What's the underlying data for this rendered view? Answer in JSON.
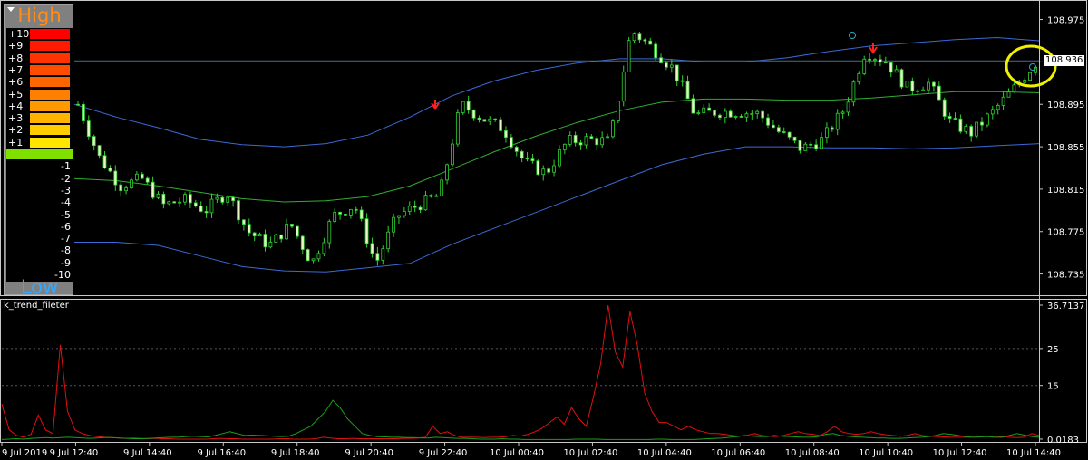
{
  "gauge": {
    "high_label": "High",
    "low_label": "Low",
    "levels": [
      {
        "label": "+10",
        "color": "#ff0000"
      },
      {
        "label": "+9",
        "color": "#ff1a00"
      },
      {
        "label": "+8",
        "color": "#ff3300"
      },
      {
        "label": "+7",
        "color": "#ff4d00"
      },
      {
        "label": "+6",
        "color": "#ff6600"
      },
      {
        "label": "+5",
        "color": "#ff8000"
      },
      {
        "label": "+4",
        "color": "#ff9900"
      },
      {
        "label": "+3",
        "color": "#ffb300"
      },
      {
        "label": "+2",
        "color": "#ffcc00"
      },
      {
        "label": "+1",
        "color": "#ffe600"
      },
      {
        "label": "",
        "color": "#7fe000"
      },
      {
        "label": "-1",
        "color": ""
      },
      {
        "label": "-2",
        "color": ""
      },
      {
        "label": "-3",
        "color": ""
      },
      {
        "label": "-4",
        "color": ""
      },
      {
        "label": "-5",
        "color": ""
      },
      {
        "label": "-6",
        "color": ""
      },
      {
        "label": "-7",
        "color": ""
      },
      {
        "label": "-8",
        "color": ""
      },
      {
        "label": "-9",
        "color": ""
      },
      {
        "label": "-10",
        "color": ""
      }
    ]
  },
  "chart_data": [
    {
      "type": "line",
      "ylim": [
        108.715,
        108.99
      ],
      "ticks": [
        "108.975",
        "108.935",
        "108.895",
        "108.855",
        "108.815",
        "108.775",
        "108.735"
      ],
      "tick_values": [
        108.975,
        108.935,
        108.895,
        108.855,
        108.815,
        108.775,
        108.735
      ],
      "current_price": "108.936",
      "current_value": 108.936,
      "x_labels": [
        "9 Jul 2019",
        "9 Jul 12:40",
        "9 Jul 14:40",
        "9 Jul 16:40",
        "9 Jul 18:40",
        "9 Jul 20:40",
        "9 Jul 22:40",
        "10 Jul 00:40",
        "10 Jul 02:40",
        "10 Jul 04:40",
        "10 Jul 06:40",
        "10 Jul 08:40",
        "10 Jul 10:40",
        "10 Jul 12:40",
        "10 Jul 14:40"
      ],
      "close_anchors": [
        108.895,
        108.845,
        108.818,
        108.825,
        108.8,
        108.805,
        108.795,
        108.812,
        108.775,
        108.762,
        108.782,
        108.745,
        108.79,
        108.8,
        108.745,
        108.79,
        108.8,
        108.81,
        108.895,
        108.882,
        108.872,
        108.84,
        108.83,
        108.86,
        108.862,
        108.86,
        108.965,
        108.948,
        108.928,
        108.885,
        108.888,
        108.888,
        108.886,
        108.868,
        108.853,
        108.862,
        108.89,
        108.945,
        108.935,
        108.91,
        108.915,
        108.878,
        108.868,
        108.888,
        108.91,
        108.934
      ],
      "series": [
        {
          "name": "",
          "color": "#3a6ad4",
          "values": [
            108.765,
            108.765,
            108.762,
            108.752,
            108.742,
            108.738,
            108.737,
            108.741,
            108.745,
            108.763,
            108.778,
            108.793,
            108.808,
            108.823,
            108.838,
            108.848,
            108.855,
            108.855,
            108.854,
            108.854,
            108.853,
            108.854,
            108.856,
            108.858
          ]
        },
        {
          "name": "",
          "color": "#2fae2f",
          "values": [
            108.825,
            108.823,
            108.818,
            108.812,
            108.806,
            108.803,
            108.804,
            108.808,
            108.818,
            108.834,
            108.85,
            108.865,
            108.878,
            108.889,
            108.897,
            108.9,
            108.9,
            108.899,
            108.899,
            108.901,
            108.904,
            108.907,
            108.907,
            108.906
          ]
        },
        {
          "name": "",
          "color": "#3a6ad4",
          "values": [
            108.895,
            108.883,
            108.873,
            108.862,
            108.857,
            108.855,
            108.858,
            108.866,
            108.883,
            108.903,
            108.917,
            108.927,
            108.934,
            108.938,
            108.938,
            108.935,
            108.935,
            108.939,
            108.945,
            108.95,
            108.953,
            108.956,
            108.958,
            108.955
          ]
        }
      ]
    },
    {
      "type": "line",
      "title": "k_trend_fileter",
      "ylim": [
        0,
        36.7137
      ],
      "ticks": [
        "36.7137",
        "25",
        "15",
        "0.0183"
      ],
      "tick_values": [
        36.7137,
        25,
        15,
        0.5
      ],
      "series": [
        {
          "name": "",
          "color": "#e01010",
          "values": [
            10,
            3,
            1.5,
            1,
            1.8,
            7,
            3,
            2,
            26,
            8,
            3,
            2,
            1.5,
            1.2,
            1,
            0.9,
            0.8,
            0.7,
            0.8,
            0.7,
            0.6,
            0.7,
            0.6,
            0.6,
            0.5,
            0.5,
            0.5,
            0.5,
            0.5,
            0.6,
            0.7,
            0.6,
            0.6,
            0.5,
            0.5,
            0.5,
            0.5,
            0.5,
            0.6,
            0.6,
            0.5,
            0.5,
            0.5,
            0.6,
            1,
            0.8,
            0.6,
            0.6,
            0.7,
            0.6,
            0.6,
            0.6,
            0.6,
            0.6,
            0.6,
            0.7,
            0.7,
            0.8,
            1,
            4,
            2,
            2.5,
            1.5,
            1,
            1,
            1,
            0.9,
            1,
            1,
            1.2,
            1.5,
            1.3,
            1.8,
            2.5,
            3.5,
            5,
            6.5,
            4.5,
            9,
            6,
            4,
            12,
            21,
            36.7,
            24,
            20,
            35,
            26,
            13,
            8,
            5,
            5,
            4,
            3,
            4,
            3,
            2.5,
            2,
            2,
            1.8,
            1.5,
            1.3,
            1.5,
            2,
            1.5,
            1.3,
            1.2,
            1.5,
            2,
            2.5,
            2,
            1.8,
            1.5,
            2.5,
            4,
            2.5,
            2,
            1.8,
            2,
            2.5,
            2,
            1.7,
            1.5,
            1.3,
            1.5,
            2,
            1.5,
            1.3,
            1.2,
            1.1,
            1,
            1,
            1,
            1,
            1.1,
            1.3,
            1,
            1.2,
            1,
            0.9,
            1,
            2,
            1.5
          ]
        },
        {
          "name": "",
          "color": "#1aa01a",
          "values": [
            0.4,
            0.5,
            0.6,
            0.5,
            0.7,
            0.8,
            0.9,
            0.8,
            0.9,
            1,
            0.9,
            0.8,
            0.7,
            0.8,
            0.9,
            0.9,
            0.8,
            0.7,
            0.6,
            0.6,
            0.7,
            0.8,
            0.9,
            1,
            1,
            1.2,
            1.3,
            1.2,
            1.1,
            1.5,
            2,
            2.5,
            2,
            1.5,
            1.6,
            1.5,
            1.4,
            1.3,
            1.2,
            1.3,
            2,
            3,
            4,
            6,
            8,
            11,
            9,
            6,
            4,
            2,
            1.5,
            1.2,
            1.1,
            1,
            1,
            0.9,
            0.9,
            0.8,
            0.8,
            1,
            0.9,
            0.8,
            0.7,
            0.7,
            0.6,
            0.5,
            0.5,
            0.5,
            0.6,
            0.5,
            0.5,
            0.4,
            0.4,
            0.4,
            0.4,
            0.4,
            0.4,
            0.4,
            0.5,
            0.5,
            0.5,
            0.5,
            0.4,
            0.4,
            0.4,
            0.4,
            0.4,
            0.4,
            0.4,
            0.5,
            0.5,
            0.4,
            0.4,
            0.4,
            0.4,
            0.5,
            0.6,
            0.7,
            0.8,
            1,
            1.2,
            1.5,
            1.3,
            1.2,
            1.2,
            1.5,
            1.3,
            1.2,
            1.1,
            1,
            1,
            1.2,
            1.8,
            2,
            1.5,
            1.3,
            1.1,
            1,
            0.9,
            0.8,
            0.8,
            0.7,
            0.7,
            0.8,
            0.9,
            1,
            1.2,
            1.5,
            2,
            1.8,
            1.5,
            1.2,
            1,
            1.1,
            1.2,
            1,
            1,
            1.5,
            2,
            1.6,
            1.2,
            1
          ]
        }
      ]
    }
  ]
}
